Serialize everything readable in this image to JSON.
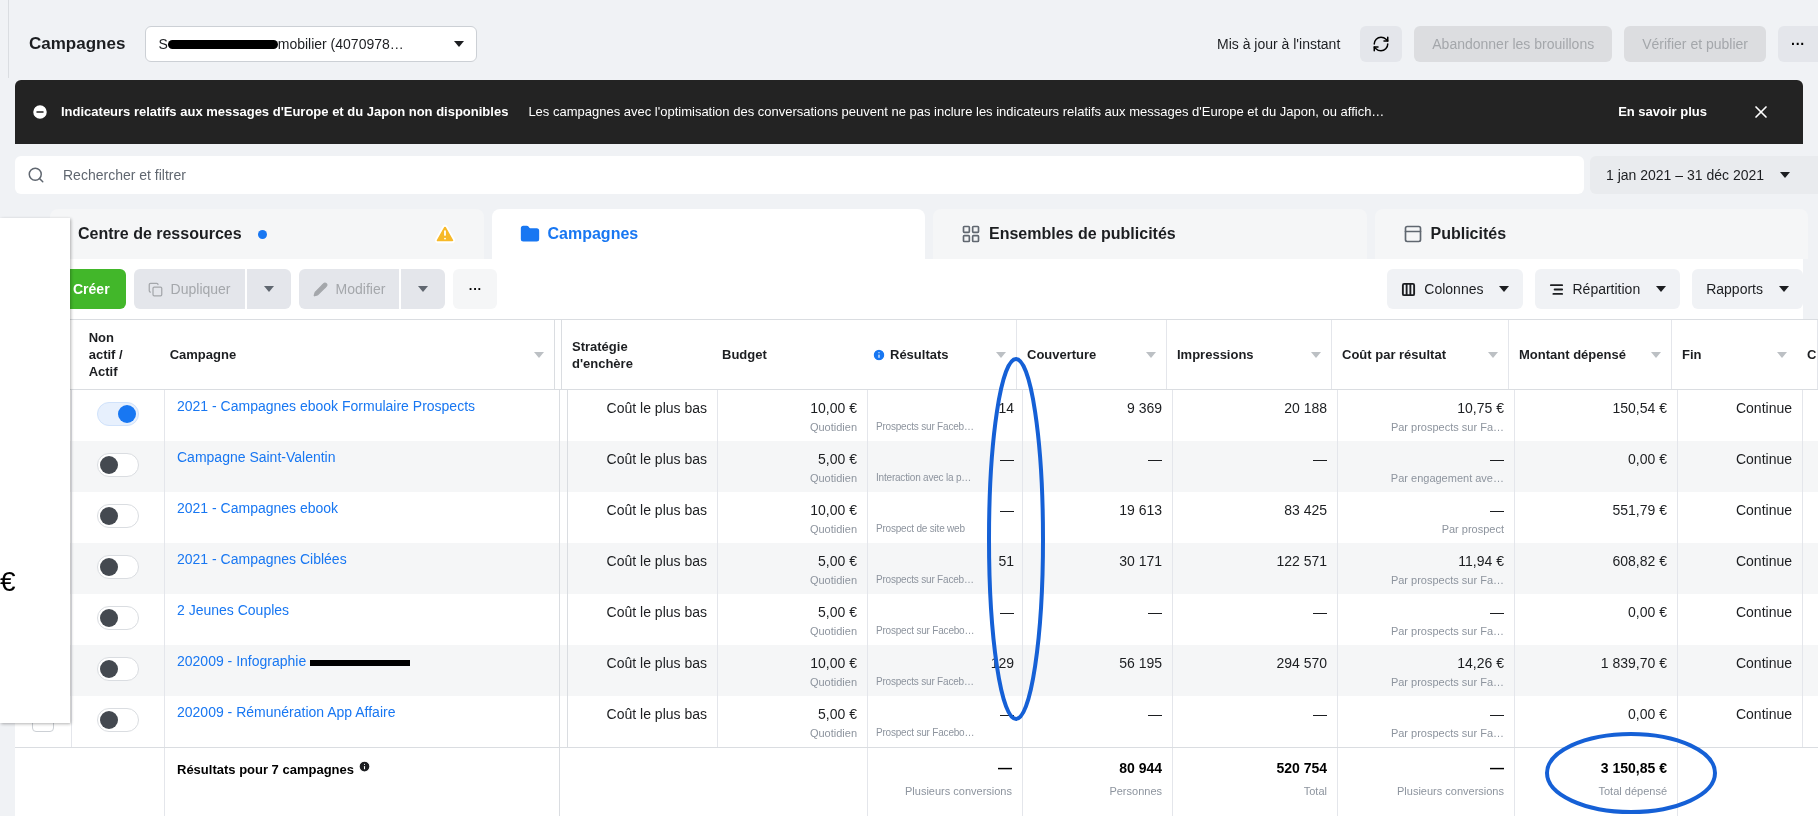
{
  "header": {
    "title": "Campagnes",
    "account": {
      "prefix": "S",
      "suffix": "mobilier (4070978…",
      "redacted": true
    },
    "status": "Mis à jour à l'instant",
    "buttons": [
      {
        "label": "Abandonner les brouillons",
        "disabled": true
      },
      {
        "label": "Vérifier et publier",
        "disabled": true
      }
    ],
    "more": "···"
  },
  "banner": {
    "title": "Indicateurs relatifs aux messages d'Europe et du Japon non disponibles",
    "text": "Les campagnes avec l'optimisation des conversations peuvent ne pas inclure les indicateurs relatifs aux messages d'Europe et du Japon, ou affich…",
    "link": "En savoir plus"
  },
  "search": {
    "placeholder": "Rechercher et filtrer"
  },
  "date_range": "1 jan 2021 – 31 déc 2021",
  "tabs": [
    {
      "label": "Centre de ressources",
      "kind": "resources",
      "selected": false
    },
    {
      "label": "Campagnes",
      "kind": "campaigns",
      "selected": true
    },
    {
      "label": "Ensembles de publicités",
      "kind": "adsets",
      "selected": false
    },
    {
      "label": "Publicités",
      "kind": "ads",
      "selected": false
    }
  ],
  "toolbar": {
    "create": "Créer",
    "left": [
      {
        "label": "Dupliquer",
        "kind": "duplicate",
        "disabled": true
      },
      {
        "label": "Modifier",
        "kind": "edit",
        "disabled": true
      }
    ],
    "more": "···",
    "right": [
      {
        "label": "Colonnes",
        "kind": "columns"
      },
      {
        "label": "Répartition",
        "kind": "breakdown"
      },
      {
        "label": "Rapports",
        "kind": "reports"
      }
    ]
  },
  "table": {
    "columns": [
      "Non actif / Actif",
      "Campagne",
      "Stratégie d'enchère",
      "Budget",
      "Résultats",
      "Couverture",
      "Impressions",
      "Coût par résultat",
      "Montant dépensé",
      "Fin",
      "C"
    ],
    "rows": [
      {
        "active": true,
        "name": "2021 - Campagnes ebook Formulaire Prospects",
        "redacted": false,
        "bid": "Coût le plus bas",
        "budget": "10,00 €",
        "period": "Quotidien",
        "results": "14",
        "results_label": "Prospects sur Faceb…",
        "reach": "9 369",
        "impressions": "20 188",
        "cpr": "10,75 €",
        "cpr_label": "Par prospects sur Fa…",
        "spent": "150,54 €",
        "end": "Continue"
      },
      {
        "active": false,
        "name": "Campagne Saint-Valentin",
        "redacted": false,
        "bid": "Coût le plus bas",
        "budget": "5,00 €",
        "period": "Quotidien",
        "results": "—",
        "results_label": "Interaction avec la p…",
        "reach": "—",
        "impressions": "—",
        "cpr": "—",
        "cpr_label": "Par engagement ave…",
        "spent": "0,00 €",
        "end": "Continue"
      },
      {
        "active": false,
        "name": "2021 - Campagnes ebook",
        "redacted": false,
        "bid": "Coût le plus bas",
        "budget": "10,00 €",
        "period": "Quotidien",
        "results": "—",
        "results_label": "Prospect de site web",
        "reach": "19 613",
        "impressions": "83 425",
        "cpr": "—",
        "cpr_label": "Par prospect",
        "spent": "551,79 €",
        "end": "Continue"
      },
      {
        "active": false,
        "name": "2021 - Campagnes Ciblées",
        "redacted": false,
        "bid": "Coût le plus bas",
        "budget": "5,00 €",
        "period": "Quotidien",
        "results": "51",
        "results_label": "Prospects sur Faceb…",
        "reach": "30 171",
        "impressions": "122 571",
        "cpr": "11,94 €",
        "cpr_label": "Par prospects sur Fa…",
        "spent": "608,82 €",
        "end": "Continue"
      },
      {
        "active": false,
        "name": "2 Jeunes Couples",
        "redacted": false,
        "bid": "Coût le plus bas",
        "budget": "5,00 €",
        "period": "Quotidien",
        "results": "—",
        "results_label": "Prospect sur Facebo…",
        "reach": "—",
        "impressions": "—",
        "cpr": "—",
        "cpr_label": "Par prospects sur Fa…",
        "spent": "0,00 €",
        "end": "Continue"
      },
      {
        "active": false,
        "name": "202009 - Infographie",
        "redacted": true,
        "bid": "Coût le plus bas",
        "budget": "10,00 €",
        "period": "Quotidien",
        "results": "129",
        "results_label": "Prospects sur Faceb…",
        "reach": "56 195",
        "impressions": "294 570",
        "cpr": "14,26 €",
        "cpr_label": "Par prospects sur Fa…",
        "spent": "1 839,70 €",
        "end": "Continue"
      },
      {
        "active": false,
        "name": "202009 - Rémunération App Affaire",
        "redacted": false,
        "bid": "Coût le plus bas",
        "budget": "5,00 €",
        "period": "Quotidien",
        "results": "—",
        "results_label": "Prospect sur Facebo…",
        "reach": "—",
        "impressions": "—",
        "cpr": "—",
        "cpr_label": "Par prospects sur Fa…",
        "spent": "0,00 €",
        "end": "Continue"
      }
    ],
    "totals": {
      "label": "Résultats pour 7 campagnes",
      "results": "—",
      "results_label": "Plusieurs conversions",
      "reach": "80 944",
      "reach_label": "Personnes",
      "impressions": "520 754",
      "impressions_label": "Total",
      "cpr": "—",
      "cpr_label": "Plusieurs conversions",
      "spent": "3 150,85 €",
      "spent_label": "Total dépensé"
    }
  },
  "overlay": {
    "text": "€"
  }
}
